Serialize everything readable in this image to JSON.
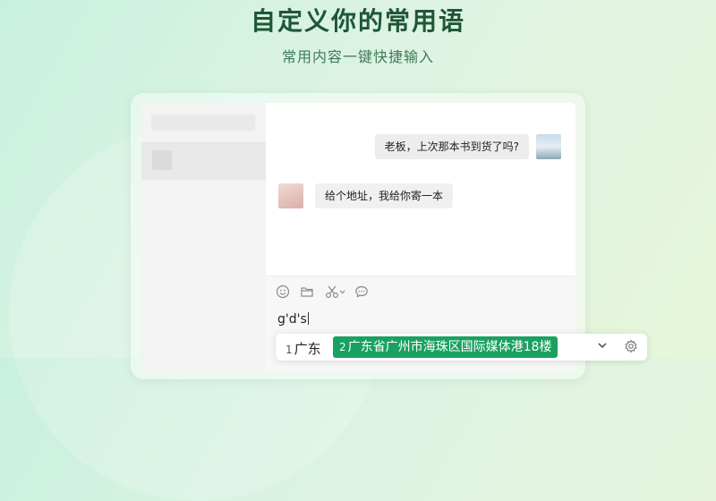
{
  "hero": {
    "title": "自定义你的常用语",
    "subtitle": "常用内容一键快捷输入"
  },
  "chat": {
    "messages": [
      {
        "from": "self",
        "text": "老板，上次那本书到货了吗?"
      },
      {
        "from": "other",
        "text": "给个地址，我给你寄一本"
      }
    ]
  },
  "composer": {
    "toolbar_icons": [
      "emoji-icon",
      "folder-icon",
      "scissors-icon",
      "chat-history-icon"
    ],
    "typed_text": "g'd's"
  },
  "ime": {
    "candidates": [
      {
        "index": "1",
        "text": "广东",
        "selected": false
      },
      {
        "index": "2",
        "text": "广东省广州市海珠区国际媒体港18楼",
        "selected": true
      }
    ],
    "accent_color": "#1aa160"
  }
}
